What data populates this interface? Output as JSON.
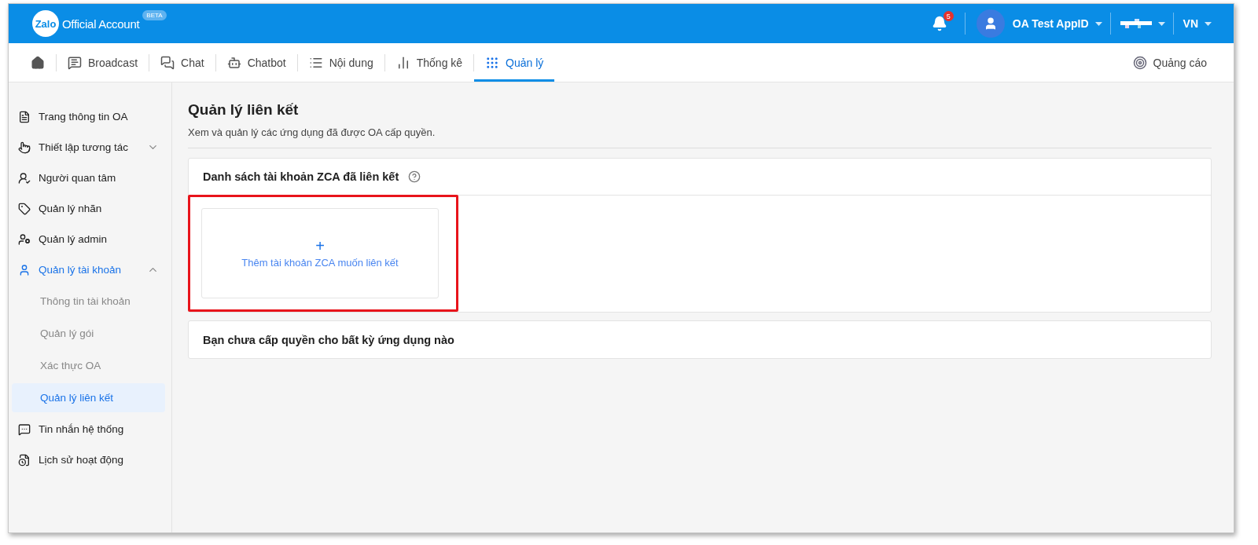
{
  "header": {
    "logo": "Zalo",
    "product": "Official Account",
    "beta_badge": "BETA",
    "notification_count": "5",
    "account_name": "OA Test AppID",
    "language": "VN"
  },
  "nav": {
    "tabs": [
      {
        "label": "Broadcast",
        "selected": false
      },
      {
        "label": "Chat",
        "selected": false
      },
      {
        "label": "Chatbot",
        "selected": false
      },
      {
        "label": "Nội dung",
        "selected": false
      },
      {
        "label": "Thống kê",
        "selected": false
      },
      {
        "label": "Quản lý",
        "selected": true
      }
    ],
    "ads_link": "Quảng cáo"
  },
  "sidebar": {
    "items": [
      {
        "label": "Trang thông tin OA",
        "selected": false
      },
      {
        "label": "Thiết lập tương tác",
        "selected": false,
        "expanded": false
      },
      {
        "label": "Người quan tâm",
        "selected": false
      },
      {
        "label": "Quản lý nhãn",
        "selected": false
      },
      {
        "label": "Quản lý admin",
        "selected": false
      },
      {
        "label": "Quản lý tài khoản",
        "selected": true,
        "expanded": true,
        "children": [
          {
            "label": "Thông tin tài khoản",
            "selected": false
          },
          {
            "label": "Quản lý gói",
            "selected": false
          },
          {
            "label": "Xác thực OA",
            "selected": false
          },
          {
            "label": "Quản lý liên kết",
            "selected": true
          }
        ]
      },
      {
        "label": "Tin nhắn hệ thống",
        "selected": false
      },
      {
        "label": "Lịch sử hoạt động",
        "selected": false
      }
    ]
  },
  "page": {
    "title": "Quản lý liên kết",
    "subtitle": "Xem và quản lý các ứng dụng đã được OA cấp quyền.",
    "linked_section": {
      "title": "Danh sách tài khoản ZCA đã liên kết",
      "add_card": {
        "icon_text": "+",
        "label": "Thêm tài khoản ZCA muốn liên kết",
        "highlighted": true
      }
    },
    "apps_section": {
      "title": "Bạn chưa cấp quyền cho bất kỳ ứng dụng nào"
    }
  }
}
